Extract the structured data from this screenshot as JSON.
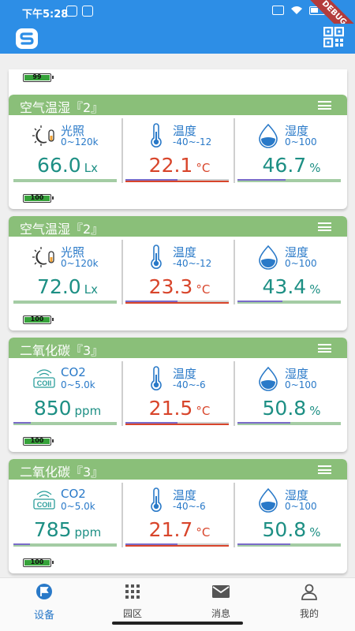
{
  "status_bar": {
    "time": "下午5:28",
    "debug_label": "DEBUG"
  },
  "top_stub": {
    "battery": "99"
  },
  "cards": [
    {
      "title": "空气温湿『2』",
      "battery": "100",
      "sensors": [
        {
          "icon": "light-icon",
          "name": "光照",
          "range": "0~120k",
          "value": "66.0",
          "unit": "Lx",
          "color": "#1d8f84",
          "bar_fraction": 0.0
        },
        {
          "icon": "thermometer-icon",
          "name": "温度",
          "range": "-40~-12",
          "value": "22.1",
          "unit": "°C",
          "color": "#d8452b",
          "bar_fraction": 0.5
        },
        {
          "icon": "water-drop-icon",
          "name": "湿度",
          "range": "0~100",
          "value": "46.7",
          "unit": "%",
          "color": "#1d8f84",
          "bar_fraction": 0.467
        }
      ]
    },
    {
      "title": "空气温湿『2』",
      "battery": "100",
      "sensors": [
        {
          "icon": "light-icon",
          "name": "光照",
          "range": "0~120k",
          "value": "72.0",
          "unit": "Lx",
          "color": "#1d8f84",
          "bar_fraction": 0.0
        },
        {
          "icon": "thermometer-icon",
          "name": "温度",
          "range": "-40~-12",
          "value": "23.3",
          "unit": "°C",
          "color": "#d8452b",
          "bar_fraction": 0.5
        },
        {
          "icon": "water-drop-icon",
          "name": "湿度",
          "range": "0~100",
          "value": "43.4",
          "unit": "%",
          "color": "#1d8f84",
          "bar_fraction": 0.434
        }
      ]
    },
    {
      "title": "二氧化碳『3』",
      "battery": "100",
      "sensors": [
        {
          "icon": "co2-icon",
          "name": "CO2",
          "range": "0~5.0k",
          "value": "850",
          "unit": "ppm",
          "color": "#1d8f84",
          "bar_fraction": 0.17
        },
        {
          "icon": "thermometer-icon",
          "name": "温度",
          "range": "-40~-6",
          "value": "21.5",
          "unit": "°C",
          "color": "#d8452b",
          "bar_fraction": 0.5
        },
        {
          "icon": "water-drop-icon",
          "name": "湿度",
          "range": "0~100",
          "value": "50.8",
          "unit": "%",
          "color": "#1d8f84",
          "bar_fraction": 0.508
        }
      ]
    },
    {
      "title": "二氧化碳『3』",
      "battery": "100",
      "sensors": [
        {
          "icon": "co2-icon",
          "name": "CO2",
          "range": "0~5.0k",
          "value": "785",
          "unit": "ppm",
          "color": "#1d8f84",
          "bar_fraction": 0.157
        },
        {
          "icon": "thermometer-icon",
          "name": "温度",
          "range": "-40~-6",
          "value": "21.7",
          "unit": "°C",
          "color": "#d8452b",
          "bar_fraction": 0.5
        },
        {
          "icon": "water-drop-icon",
          "name": "湿度",
          "range": "0~100",
          "value": "50.8",
          "unit": "%",
          "color": "#1d8f84",
          "bar_fraction": 0.508
        }
      ]
    }
  ],
  "bottom_nav": [
    {
      "label": "设备",
      "icon": "flag-icon",
      "active": true
    },
    {
      "label": "园区",
      "icon": "grid-icon",
      "active": false
    },
    {
      "label": "消息",
      "icon": "mail-icon",
      "active": false
    },
    {
      "label": "我的",
      "icon": "person-icon",
      "active": false
    }
  ],
  "colors": {
    "primary": "#2d8ee6",
    "card_header": "#8abf79",
    "value_teal": "#1d8f84",
    "value_red": "#d8452b",
    "bar_purple": "#7a6cc9",
    "bar_green": "#a4cca4"
  }
}
